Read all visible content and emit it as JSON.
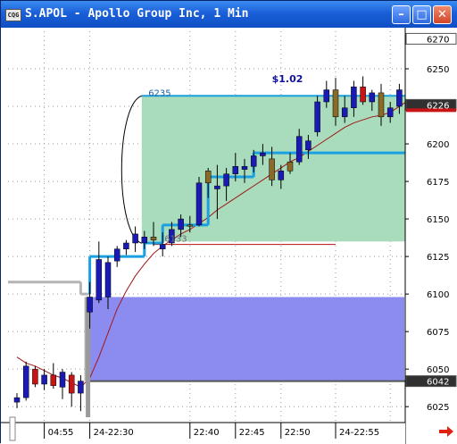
{
  "window": {
    "title": "S.APOL - Apollo Group Inc, 1 Min",
    "icon": "chart-app-icon",
    "buttons": {
      "minimize": "minimize-icon",
      "maximize": "maximize-icon",
      "close": "close-icon"
    }
  },
  "colors": {
    "titlebar": "#1a5fd8",
    "up_candle": "#1a1ab4",
    "down_candle": "#c81414",
    "neutral_candle": "#8a6a28",
    "step_line": "#1aa0e0",
    "moving_average": "#a01818",
    "green_zone": "#a8dcbc",
    "blue_zone": "#8c8cf0",
    "accent_arrow": "#e02010"
  },
  "chart_data": {
    "type": "candlestick",
    "y_axis": {
      "range": [
        6015,
        6275
      ],
      "ticks": [
        "6025",
        "6050",
        "6075",
        "6100",
        "6125",
        "6150",
        "6175",
        "6200",
        "6250"
      ],
      "boxed_labels": [
        {
          "text": "6270",
          "value": 6270,
          "style": "white"
        },
        {
          "text": "6226",
          "value": 6226,
          "style": "dark"
        },
        {
          "text": "6042",
          "value": 6042,
          "style": "dark"
        }
      ]
    },
    "x_axis": {
      "ticks": [
        "04:55",
        "24-22:30",
        "22:40",
        "22:45",
        "22:50",
        "24-22:55"
      ]
    },
    "annotations": [
      {
        "text": "6235",
        "x_index": 16,
        "value": 6232
      },
      {
        "text": "$1.02",
        "x_index": 28,
        "value": 6241
      },
      {
        "text": "6133",
        "x_index": 16,
        "value": 6135
      }
    ],
    "candles": [
      {
        "o": 6028,
        "h": 6034,
        "l": 6024,
        "c": 6031,
        "dir": "up"
      },
      {
        "o": 6031,
        "h": 6055,
        "l": 6029,
        "c": 6052,
        "dir": "up"
      },
      {
        "o": 6050,
        "h": 6052,
        "l": 6038,
        "c": 6040,
        "dir": "down"
      },
      {
        "o": 6040,
        "h": 6050,
        "l": 6036,
        "c": 6046,
        "dir": "up"
      },
      {
        "o": 6046,
        "h": 6054,
        "l": 6037,
        "c": 6039,
        "dir": "down"
      },
      {
        "o": 6038,
        "h": 6050,
        "l": 6030,
        "c": 6048,
        "dir": "up"
      },
      {
        "o": 6046,
        "h": 6048,
        "l": 6025,
        "c": 6034,
        "dir": "down"
      },
      {
        "o": 6034,
        "h": 6046,
        "l": 6022,
        "c": 6042,
        "dir": "up"
      },
      {
        "o": 6088,
        "h": 6108,
        "l": 6077,
        "c": 6098,
        "dir": "up"
      },
      {
        "o": 6096,
        "h": 6135,
        "l": 6094,
        "c": 6123,
        "dir": "up"
      },
      {
        "o": 6098,
        "h": 6125,
        "l": 6090,
        "c": 6121,
        "dir": "up"
      },
      {
        "o": 6122,
        "h": 6132,
        "l": 6118,
        "c": 6130,
        "dir": "up"
      },
      {
        "o": 6130,
        "h": 6136,
        "l": 6126,
        "c": 6134,
        "dir": "up"
      },
      {
        "o": 6134,
        "h": 6145,
        "l": 6128,
        "c": 6140,
        "dir": "up"
      },
      {
        "o": 6134,
        "h": 6142,
        "l": 6130,
        "c": 6138,
        "dir": "up"
      },
      {
        "o": 6138,
        "h": 6148,
        "l": 6132,
        "c": 6136,
        "dir": "neutral"
      },
      {
        "o": 6130,
        "h": 6141,
        "l": 6125,
        "c": 6133,
        "dir": "up"
      },
      {
        "o": 6134,
        "h": 6148,
        "l": 6132,
        "c": 6143,
        "dir": "up"
      },
      {
        "o": 6143,
        "h": 6153,
        "l": 6138,
        "c": 6150,
        "dir": "up"
      },
      {
        "o": 6146,
        "h": 6152,
        "l": 6141,
        "c": 6146,
        "dir": "neutral"
      },
      {
        "o": 6146,
        "h": 6178,
        "l": 6145,
        "c": 6174,
        "dir": "up"
      },
      {
        "o": 6174,
        "h": 6184,
        "l": 6164,
        "c": 6182,
        "dir": "neutral"
      },
      {
        "o": 6170,
        "h": 6186,
        "l": 6150,
        "c": 6172,
        "dir": "up"
      },
      {
        "o": 6172,
        "h": 6184,
        "l": 6162,
        "c": 6180,
        "dir": "up"
      },
      {
        "o": 6180,
        "h": 6194,
        "l": 6175,
        "c": 6185,
        "dir": "up"
      },
      {
        "o": 6183,
        "h": 6190,
        "l": 6174,
        "c": 6185,
        "dir": "up"
      },
      {
        "o": 6185,
        "h": 6196,
        "l": 6181,
        "c": 6192,
        "dir": "up"
      },
      {
        "o": 6192,
        "h": 6200,
        "l": 6186,
        "c": 6194,
        "dir": "up"
      },
      {
        "o": 6190,
        "h": 6198,
        "l": 6172,
        "c": 6176,
        "dir": "neutral"
      },
      {
        "o": 6176,
        "h": 6186,
        "l": 6170,
        "c": 6182,
        "dir": "up"
      },
      {
        "o": 6182,
        "h": 6194,
        "l": 6180,
        "c": 6188,
        "dir": "neutral"
      },
      {
        "o": 6188,
        "h": 6210,
        "l": 6186,
        "c": 6205,
        "dir": "up"
      },
      {
        "o": 6196,
        "h": 6206,
        "l": 6190,
        "c": 6202,
        "dir": "up"
      },
      {
        "o": 6208,
        "h": 6232,
        "l": 6205,
        "c": 6228,
        "dir": "up"
      },
      {
        "o": 6228,
        "h": 6242,
        "l": 6224,
        "c": 6236,
        "dir": "up"
      },
      {
        "o": 6236,
        "h": 6244,
        "l": 6212,
        "c": 6218,
        "dir": "neutral"
      },
      {
        "o": 6218,
        "h": 6232,
        "l": 6214,
        "c": 6224,
        "dir": "up"
      },
      {
        "o": 6224,
        "h": 6242,
        "l": 6218,
        "c": 6238,
        "dir": "up"
      },
      {
        "o": 6238,
        "h": 6245,
        "l": 6226,
        "c": 6228,
        "dir": "down"
      },
      {
        "o": 6228,
        "h": 6236,
        "l": 6222,
        "c": 6234,
        "dir": "up"
      },
      {
        "o": 6234,
        "h": 6240,
        "l": 6212,
        "c": 6218,
        "dir": "neutral"
      },
      {
        "o": 6218,
        "h": 6228,
        "l": 6214,
        "c": 6224,
        "dir": "up"
      },
      {
        "o": 6225,
        "h": 6240,
        "l": 6220,
        "c": 6236,
        "dir": "up"
      },
      {
        "o": 6236,
        "h": 6256,
        "l": 6230,
        "c": 6246,
        "dir": "up"
      },
      {
        "o": 6246,
        "h": 6252,
        "l": 6232,
        "c": 6236,
        "dir": "down"
      },
      {
        "o": 6234,
        "h": 6246,
        "l": 6228,
        "c": 6238,
        "dir": "up"
      },
      {
        "o": 6238,
        "h": 6252,
        "l": 6232,
        "c": 6246,
        "dir": "up"
      },
      {
        "o": 6230,
        "h": 6256,
        "l": 6228,
        "c": 6250,
        "dir": "up"
      }
    ],
    "step_line": [
      {
        "from": 0,
        "to": 7,
        "value": 6108,
        "color": "gray"
      },
      {
        "from": 7,
        "to": 8,
        "value": 6100,
        "color": "gray"
      },
      {
        "from": 8,
        "to": 14,
        "value": 6125,
        "color": "blue"
      },
      {
        "from": 14,
        "to": 16,
        "value": 6134,
        "color": "blue"
      },
      {
        "from": 16,
        "to": 21,
        "value": 6146,
        "color": "blue"
      },
      {
        "from": 21,
        "to": 26,
        "value": 6178,
        "color": "blue"
      },
      {
        "from": 26,
        "to": 43,
        "value": 6194,
        "color": "blue"
      },
      {
        "from": 43,
        "to": 47,
        "value": 6245,
        "color": "blue"
      }
    ],
    "moving_average": [
      6058,
      6054,
      6052,
      6049,
      6046,
      6044,
      6041,
      6038,
      6044,
      6058,
      6074,
      6090,
      6102,
      6112,
      6120,
      6127,
      6132,
      6136,
      6140,
      6143,
      6147,
      6151,
      6156,
      6160,
      6164,
      6168,
      6172,
      6176,
      6180,
      6184,
      6188,
      6191,
      6195,
      6199,
      6203,
      6207,
      6211,
      6214,
      6216,
      6218,
      6219,
      6221,
      6225,
      6229,
      6233,
      6236,
      6239,
      6230
    ],
    "zones": [
      {
        "name": "green",
        "from": 14,
        "to": 46,
        "low": 6135,
        "high": 6232
      },
      {
        "name": "blue",
        "from": 8,
        "to": 47,
        "low": 6042,
        "high": 6098
      }
    ],
    "levels": [
      {
        "value": 6133,
        "from": 15,
        "to": 35,
        "color": "red"
      },
      {
        "value": 6042,
        "from": 8,
        "to": 47,
        "color": "gray"
      }
    ],
    "grid": true
  }
}
